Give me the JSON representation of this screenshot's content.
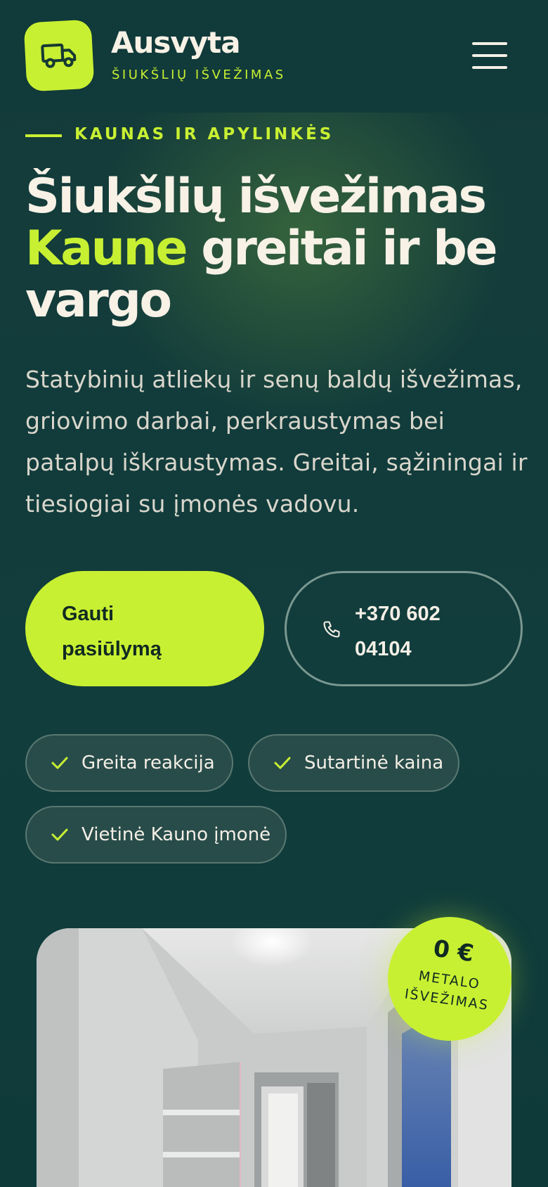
{
  "header": {
    "brand_name": "Ausvyta",
    "brand_sub": "ŠIUKŠLIŲ IŠVEŽIMAS",
    "logo_icon": "truck-icon",
    "menu_icon": "hamburger-menu-icon"
  },
  "hero": {
    "eyebrow": "KAUNAS IR APYLINKĖS",
    "headline_part1": "Šiukšlių išvežimas",
    "headline_accent": "Kaune",
    "headline_part2": "greitai ir be vargo",
    "lead": "Statybinių atliekų ir senų baldų išvežimas, griovimo darbai, perkraustymas bei patalpų iškraustymas. Greitai, sąžiningai ir tiesiogiai su įmonės vadovu.",
    "cta_primary": "Gauti pasiūlymą",
    "cta_phone": "+370 602 04104",
    "phone_icon": "phone-icon"
  },
  "features": [
    {
      "label": "Greita reakcija",
      "icon": "check-icon"
    },
    {
      "label": "Sutartinė kaina",
      "icon": "check-icon"
    },
    {
      "label": "Vietinė Kauno įmonė",
      "icon": "check-icon"
    }
  ],
  "badge": {
    "amount": "0 €",
    "line1": "METALO",
    "line2": "IŠVEŽIMAS"
  },
  "colors": {
    "accent": "#c8f032",
    "background": "#123c3b",
    "text": "#f4efe6"
  }
}
